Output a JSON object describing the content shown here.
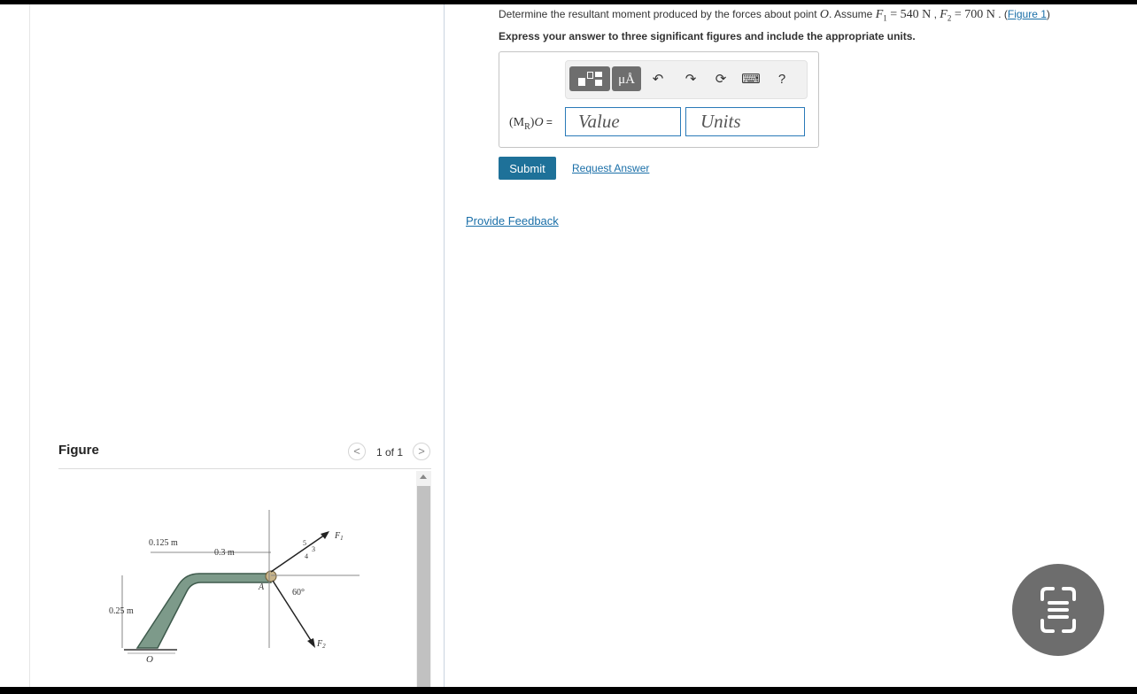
{
  "question": {
    "text_before": "Determine the resultant moment produced by the forces about point ",
    "point": "O",
    "text_assume": ". Assume ",
    "f1_symbol": "F",
    "f1_sub": "1",
    "f1_value": " = 540 N",
    "separator": " , ",
    "f2_symbol": "F",
    "f2_sub": "2",
    "f2_value": " = 700 N",
    "period": " . (",
    "figure_link": "Figure 1",
    "close": ")"
  },
  "instruction": "Express your answer to three significant figures and include the appropriate units.",
  "answer": {
    "label_open": "(M",
    "label_sub": "R",
    "label_close": ")",
    "label_point": "O",
    "label_equals": " =",
    "value_placeholder": "Value",
    "units_placeholder": "Units"
  },
  "toolbar": {
    "template_icon": "templates-icon",
    "units_symbol": "μÅ",
    "undo": "↶",
    "redo": "↷",
    "reset": "⟳",
    "keyboard": "⌨",
    "help": "?"
  },
  "actions": {
    "submit": "Submit",
    "request_answer": "Request Answer",
    "feedback": "Provide Feedback"
  },
  "figure_panel": {
    "label": "Figure",
    "prev": "<",
    "next": ">",
    "pager": "1 of 1"
  },
  "diagram_labels": {
    "dim_0125": "0.125 m",
    "dim_03": "0.3 m",
    "dim_025": "0.25 m",
    "point_O": "O",
    "point_A": "A",
    "angle": "60°",
    "slope_5": "5",
    "slope_3": "3",
    "slope_4": "4",
    "force_1": "F",
    "force_1_sub": "1",
    "force_2": "F",
    "force_2_sub": "2"
  },
  "colors": {
    "accent": "#1e7199",
    "link": "#1a6fa8",
    "input_border": "#2a7ab8",
    "bracket_fill": "#7d9a8a"
  }
}
